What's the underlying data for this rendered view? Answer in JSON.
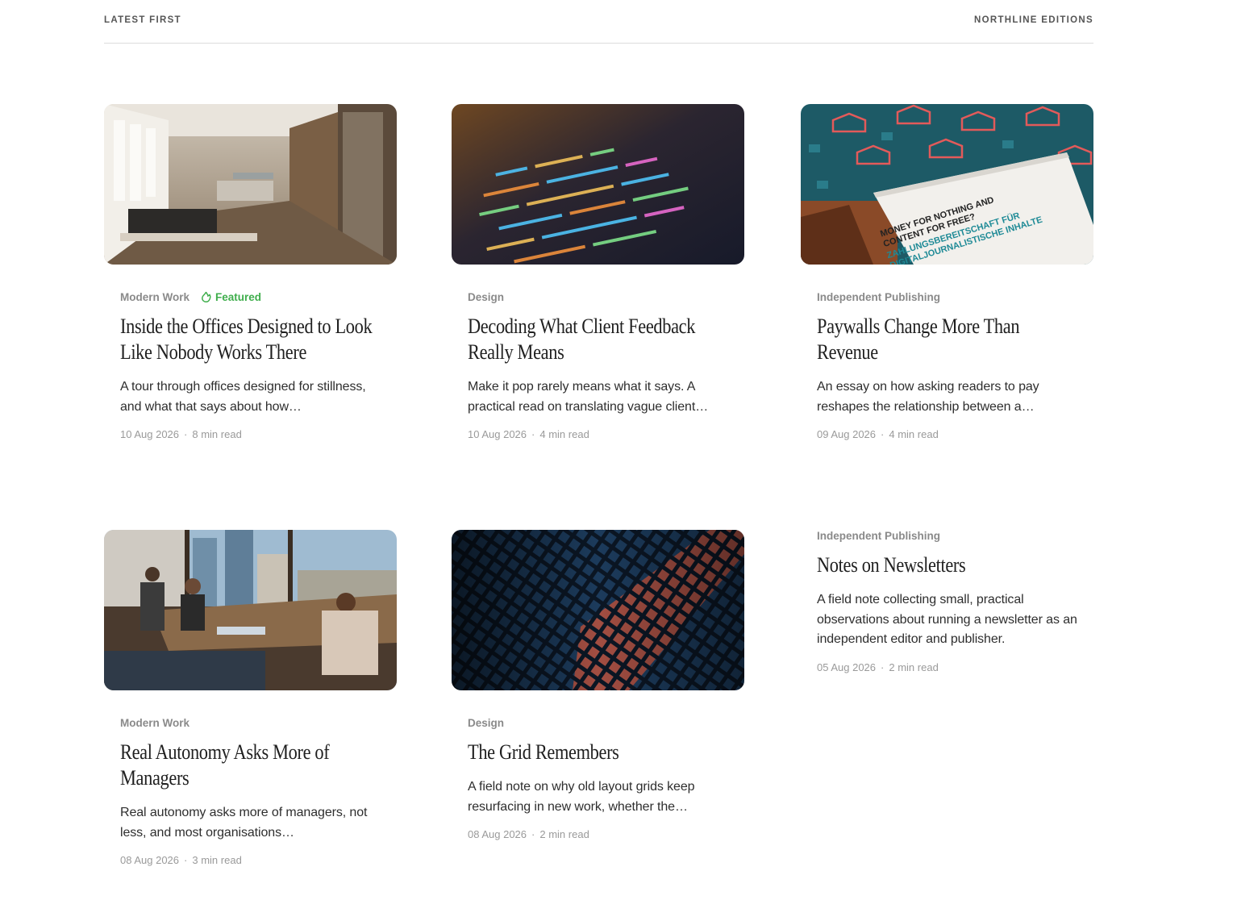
{
  "header": {
    "left_label": "LATEST FIRST",
    "right_label": "NORTHLINE EDITIONS"
  },
  "colors": {
    "featured": "#3fae4c",
    "category": "#8a8a8a",
    "meta": "#9a9a9a"
  },
  "articles": [
    {
      "category": "Modern Work",
      "featured_label": "Featured",
      "title": "Inside the Offices Designed to Look Like Nobody Works There",
      "excerpt": "A tour through offices designed for stillness, and what that says about how…",
      "date": "10 Aug 2026",
      "sep": "·",
      "read_time": "8 min read",
      "image": "empty-office-photo"
    },
    {
      "category": "Design",
      "title": "Decoding What Client Feedback Really Means",
      "excerpt": "Make it pop rarely means what it says. A practical read on translating vague client…",
      "date": "10 Aug 2026",
      "sep": "·",
      "read_time": "4 min read",
      "image": "code-screen-photo"
    },
    {
      "category": "Independent Publishing",
      "title": "Paywalls Change More Than Revenue",
      "excerpt": "An essay on how asking readers to pay reshapes the relationship between a…",
      "date": "09 Aug 2026",
      "sep": "·",
      "read_time": "4 min read",
      "image": "report-booklet-photo",
      "image_text": [
        "MONEY FOR NOTHING AND",
        "CONTENT FOR FREE?",
        "ZAHLUNGSBEREITSCHAFT FÜR",
        "DIGITALJOURNALISTISCHE INHALTE"
      ]
    },
    {
      "category": "Modern Work",
      "title": "Real Autonomy Asks More of Managers",
      "excerpt": "Real autonomy asks more of managers, not less, and most organisations…",
      "date": "08 Aug 2026",
      "sep": "·",
      "read_time": "3 min read",
      "image": "people-office-window-photo"
    },
    {
      "category": "Design",
      "title": "The Grid Remembers",
      "excerpt": "A field note on why old layout grids keep resurfacing in new work, whether the…",
      "date": "08 Aug 2026",
      "sep": "·",
      "read_time": "2 min read",
      "image": "grid-pattern-photo"
    },
    {
      "category": "Independent Publishing",
      "title": "Notes on Newsletters",
      "excerpt": "A field note collecting small, practical observations about running a newsletter as an independent editor and publisher.",
      "date": "05 Aug 2026",
      "sep": "·",
      "read_time": "2 min read"
    }
  ]
}
